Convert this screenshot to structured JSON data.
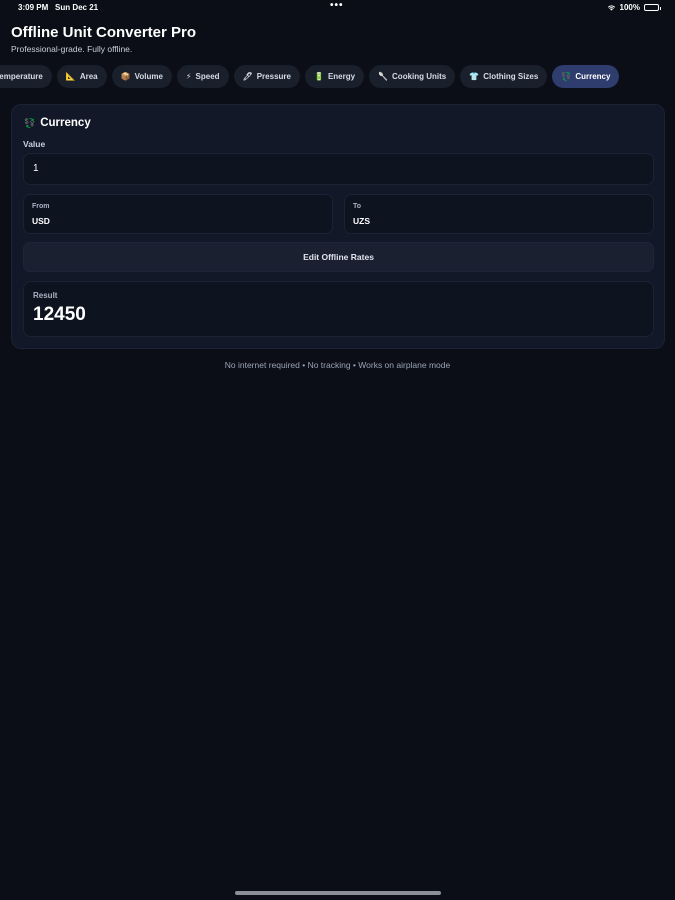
{
  "status_bar": {
    "time": "3:09 PM",
    "date": "Sun Dec 21",
    "dots": "•••",
    "battery": "100%"
  },
  "app": {
    "title": "Offline Unit Converter Pro",
    "subtitle": "Professional-grade. Fully offline."
  },
  "tabs": [
    {
      "label": "Temperature",
      "icon": "thermometer-icon",
      "glyph": "",
      "active": false
    },
    {
      "label": "Area",
      "icon": "triangle-ruler-icon",
      "glyph": "📐",
      "active": false
    },
    {
      "label": "Volume",
      "icon": "box-icon",
      "glyph": "📦",
      "active": false
    },
    {
      "label": "Speed",
      "icon": "lightning-icon",
      "glyph": "⚡",
      "active": false
    },
    {
      "label": "Pressure",
      "icon": "pen-icon",
      "glyph": "🖊",
      "active": false
    },
    {
      "label": "Energy",
      "icon": "battery-icon",
      "glyph": "🔋",
      "active": false
    },
    {
      "label": "Cooking Units",
      "icon": "utensil-icon",
      "glyph": "🥄",
      "active": false
    },
    {
      "label": "Clothing Sizes",
      "icon": "shirt-icon",
      "glyph": "👕",
      "active": false
    },
    {
      "label": "Currency",
      "icon": "currency-icon",
      "glyph": "💱",
      "active": true
    }
  ],
  "card": {
    "title": "Currency",
    "title_icon": "currency-icon",
    "value_label": "Value",
    "value": "1",
    "from_label": "From",
    "from_value": "USD",
    "to_label": "To",
    "to_value": "UZS",
    "edit_button": "Edit Offline Rates",
    "result_label": "Result",
    "result_value": "12450"
  },
  "footer": "No internet required • No tracking • Works on airplane mode",
  "colors": {
    "background": "#0b0e16",
    "card": "#121827",
    "active_tab": "#2f3c6e"
  }
}
